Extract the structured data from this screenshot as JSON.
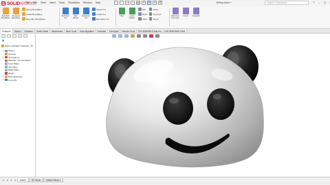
{
  "app": {
    "logo_mark": "DS",
    "logo_bold": "SOLID",
    "logo_light": "WORKS"
  },
  "menu": [
    "File",
    "Edit",
    "View",
    "Insert",
    "Tools",
    "Simulation",
    "Window",
    "Help"
  ],
  "window": {
    "title": "Jeffrey.sldprt *",
    "search_placeholder": "Search Commands",
    "controls": [
      "?",
      "–",
      "▢",
      "✕"
    ]
  },
  "ribbon": {
    "group1_big": [
      {
        "label": "Extruded Boss/Base",
        "icon": "extrude-boss-icon",
        "color": "#e8a33a"
      },
      {
        "label": "Revolved Boss/Base",
        "icon": "revolve-boss-icon",
        "color": "#e8a33a"
      }
    ],
    "group1_small": [
      {
        "label": "Swept Boss/Base",
        "icon": "swept-boss-icon",
        "color": "#e8a33a"
      },
      {
        "label": "Lofted Boss/Base",
        "icon": "lofted-boss-icon",
        "color": "#e8a33a"
      },
      {
        "label": "Boundary Boss/Base",
        "icon": "boundary-boss-icon",
        "color": "#e8a33a"
      }
    ],
    "group2_big": [
      {
        "label": "Extruded Cut",
        "icon": "extrude-cut-icon",
        "color": "#3d7ec9"
      },
      {
        "label": "Hole Wizard",
        "icon": "hole-wizard-icon",
        "color": "#3d7ec9"
      },
      {
        "label": "Revolved Cut",
        "icon": "revolve-cut-icon",
        "color": "#3d7ec9"
      }
    ],
    "group2_small": [
      {
        "label": "Swept Cut",
        "icon": "swept-cut-icon",
        "color": "#3d7ec9"
      },
      {
        "label": "Lofted Cut",
        "icon": "lofted-cut-icon",
        "color": "#3d7ec9"
      },
      {
        "label": "Boundary Cut",
        "icon": "boundary-cut-icon",
        "color": "#3d7ec9"
      }
    ],
    "group3_big": [
      {
        "label": "Fillet",
        "icon": "fillet-icon",
        "color": "#4a9d5b"
      },
      {
        "label": "Linear Pattern",
        "icon": "linear-pattern-icon",
        "color": "#4a9d5b"
      }
    ],
    "group3_small": [
      {
        "label": "Rib",
        "icon": "rib-icon",
        "color": "#7a8a99"
      },
      {
        "label": "Draft",
        "icon": "draft-icon",
        "color": "#7a8a99"
      },
      {
        "label": "Shell",
        "icon": "shell-icon",
        "color": "#7a8a99"
      }
    ],
    "group4_small": [
      {
        "label": "Wrap",
        "icon": "wrap-icon",
        "color": "#7a8a99"
      },
      {
        "label": "Intersect",
        "icon": "intersect-icon",
        "color": "#7a8a99"
      },
      {
        "label": "Mirror",
        "icon": "mirror-icon",
        "color": "#7a8a99"
      }
    ],
    "group5_big": [
      {
        "label": "Reference Geometry",
        "icon": "reference-geometry-icon",
        "color": "#8e7cc3"
      },
      {
        "label": "Curves",
        "icon": "curves-icon",
        "color": "#8e7cc3"
      },
      {
        "label": "Instant3D",
        "icon": "instant3d-icon",
        "color": "#8e7cc3"
      }
    ]
  },
  "tabs": [
    "Features",
    "Sketch",
    "Surfaces",
    "Sheet Metal",
    "Weldments",
    "Mold Tools",
    "Data Migration",
    "Evaluate",
    "DimXpert",
    "Render Tools",
    "SOLIDWORKS Add-Ins",
    "SOLIDWORKS CAM"
  ],
  "tree": {
    "filter_icon": "filter-icon",
    "part": "Jeffrey (Default<<Default>_Di",
    "nodes": [
      {
        "label": "History",
        "icon": "history-icon",
        "color": "#6f8fb0"
      },
      {
        "label": "Sensors",
        "icon": "sensor-icon",
        "color": "#d1a33b"
      },
      {
        "label": "Annotations",
        "icon": "annotation-icon",
        "color": "#c94040"
      },
      {
        "label": "Material <not specified>",
        "icon": "material-icon",
        "color": "#9b7a4a"
      },
      {
        "label": "Front Plane",
        "icon": "plane-icon",
        "color": "#9aa9b8"
      },
      {
        "label": "Top Plane",
        "icon": "plane-icon",
        "color": "#9aa9b8"
      },
      {
        "label": "Right Plane",
        "icon": "plane-icon",
        "color": "#9aa9b8"
      },
      {
        "label": "Origin",
        "icon": "origin-icon",
        "color": "#c94040"
      },
      {
        "label": "Boss-Extrude1",
        "icon": "extrude-boss-icon",
        "color": "#e8a33a"
      },
      {
        "label": "Cut-Loft1",
        "icon": "lofted-cut-icon",
        "color": "#3d7ec9"
      }
    ]
  },
  "bottom_tabs": [
    "Model",
    "3D Views",
    "Motion Study 1"
  ],
  "viewport": {
    "model": "panda-face-model"
  },
  "colors": {
    "brand": "#c8102e",
    "accent": "#1a6fc4",
    "model_body": "#e6e6e6",
    "model_features": "#111111"
  }
}
